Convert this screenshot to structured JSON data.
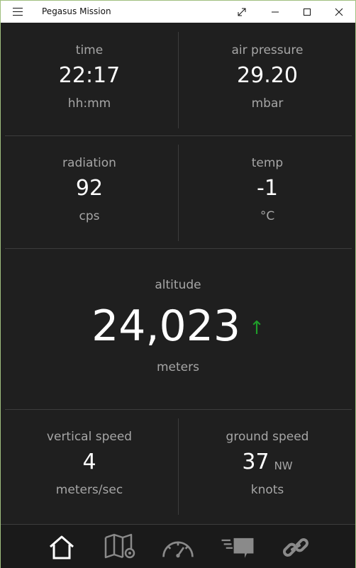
{
  "window": {
    "title": "Pegasus Mission"
  },
  "panels": {
    "time": {
      "label": "time",
      "value": "22:17",
      "unit": "hh:mm"
    },
    "air_pressure": {
      "label": "air pressure",
      "value": "29.20",
      "unit": "mbar"
    },
    "radiation": {
      "label": "radiation",
      "value": "92",
      "unit": "cps"
    },
    "temp": {
      "label": "temp",
      "value": "-1",
      "unit": "°C"
    },
    "altitude": {
      "label": "altitude",
      "value": "24,023",
      "arrow": "↑",
      "unit": "meters"
    },
    "vertical_speed": {
      "label": "vertical speed",
      "value": "4",
      "unit": "meters/sec"
    },
    "ground_speed": {
      "label": "ground speed",
      "value": "37",
      "direction": "NW",
      "unit": "knots"
    }
  },
  "colors": {
    "accent_up": "#1f9d2a",
    "background": "#1f1f1f",
    "label": "#a6a6a6"
  },
  "nav": [
    {
      "icon": "home-icon"
    },
    {
      "icon": "map-icon"
    },
    {
      "icon": "gauge-icon"
    },
    {
      "icon": "chat-icon"
    },
    {
      "icon": "link-icon"
    }
  ]
}
